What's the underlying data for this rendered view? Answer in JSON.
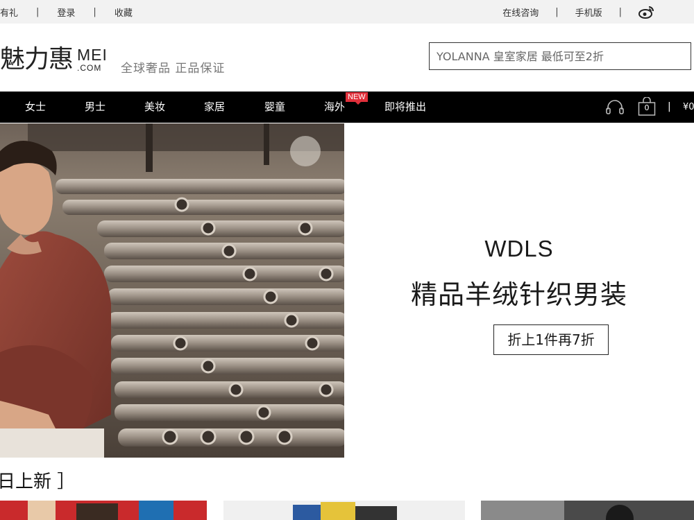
{
  "topbar": {
    "left": [
      "有礼",
      "登录",
      "收藏"
    ],
    "right": [
      "在线咨询",
      "手机版"
    ],
    "separator": "|"
  },
  "header": {
    "logo_cn": "魅力惠",
    "logo_en": "MEI",
    "logo_domain": ".COM",
    "slogan": "全球奢品  正品保证",
    "search_placeholder": "YOLANNA 皇室家居 最低可至2折"
  },
  "nav": {
    "items": [
      "女士",
      "男士",
      "美妆",
      "家居",
      "婴童",
      "海外",
      "即将推出"
    ],
    "new_badge": "NEW",
    "cart_count": "0",
    "separator": "|",
    "cart_total": "¥0"
  },
  "banner": {
    "brand": "WDLS",
    "headline": "精品羊绒针织男装",
    "offer": "折上1件再7折"
  },
  "section": {
    "title": "日上新 ］"
  },
  "colors": {
    "nav_bg": "#000000",
    "badge": "#e0303b",
    "topbar_bg": "#f2f2f2"
  }
}
